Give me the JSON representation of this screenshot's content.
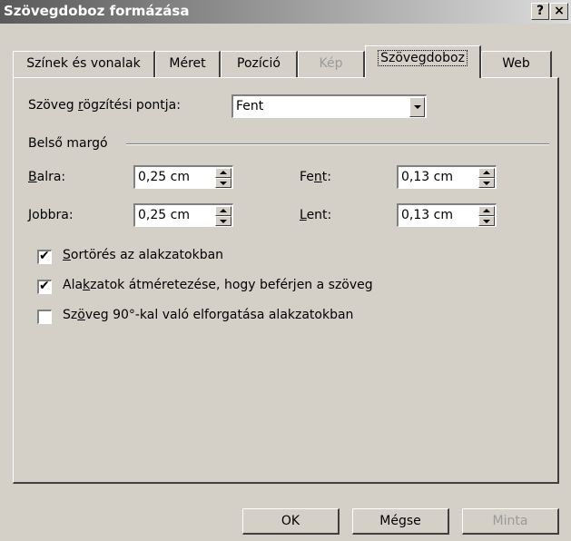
{
  "window": {
    "title": "Szövegdoboz formázása",
    "help_label": "?",
    "close_label": "×"
  },
  "tabs": [
    {
      "label": "Színek és vonalak"
    },
    {
      "label": "Méret"
    },
    {
      "label": "Pozíció"
    },
    {
      "label": "Kép"
    },
    {
      "label": "Szövegdoboz"
    },
    {
      "label": "Web"
    }
  ],
  "anchor": {
    "label_pre": "Szöveg ",
    "label_key": "r",
    "label_post": "ögzítési pontja:",
    "value": "Fent"
  },
  "margins": {
    "group_label": "Belső margó",
    "left": {
      "label_key": "B",
      "label_rest": "alra:",
      "value": "0,25 cm"
    },
    "right": {
      "label_key": "J",
      "label_rest": "obbra:",
      "value": "0,25 cm"
    },
    "top": {
      "label_pre": "Fe",
      "label_key": "n",
      "label_rest": "t:",
      "value": "0,13 cm"
    },
    "bottom": {
      "label_key": "L",
      "label_rest": "ent:",
      "value": "0,13 cm"
    }
  },
  "options": [
    {
      "pre": "",
      "key": "S",
      "rest": "ortörés az alakzatokban",
      "checked": true,
      "mark": "✔"
    },
    {
      "pre": "Ala",
      "key": "k",
      "rest": "zatok átméretezése, hogy beférjen a szöveg",
      "checked": true,
      "mark": "✔"
    },
    {
      "pre": "Sz",
      "key": "ö",
      "rest": "veg 90°-kal való elforgatása alakzatokban",
      "checked": false,
      "mark": ""
    }
  ],
  "buttons": {
    "ok": "OK",
    "cancel": "Mégse",
    "preview": "Minta"
  }
}
